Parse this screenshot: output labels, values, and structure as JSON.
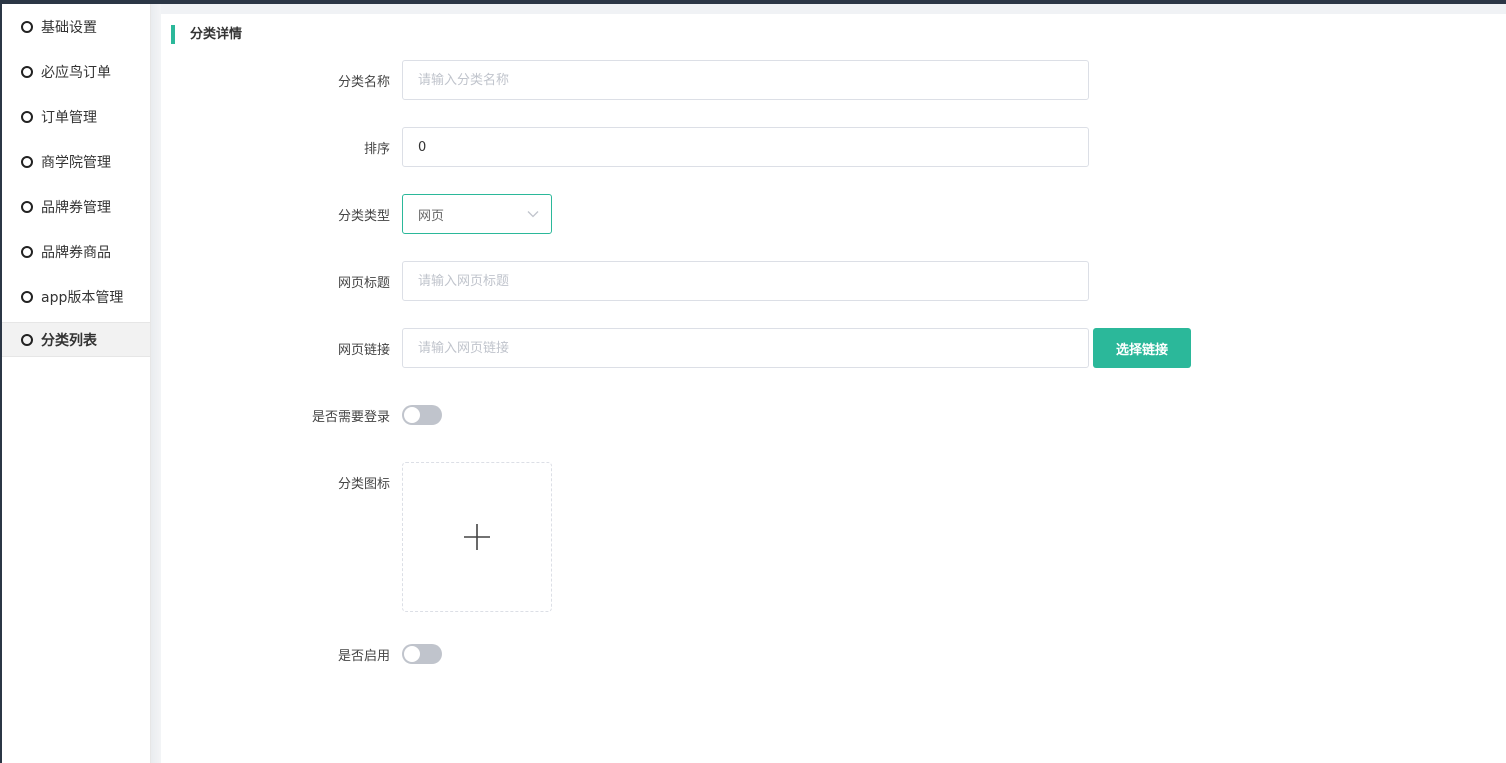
{
  "sidebar": {
    "items": [
      {
        "label": "基础设置"
      },
      {
        "label": "必应鸟订单"
      },
      {
        "label": "订单管理"
      },
      {
        "label": "商学院管理"
      },
      {
        "label": "品牌券管理"
      },
      {
        "label": "品牌券商品"
      },
      {
        "label": "app版本管理"
      },
      {
        "label": "分类列表",
        "active": true
      }
    ]
  },
  "form": {
    "section_title": "分类详情",
    "name": {
      "label": "分类名称",
      "placeholder": "请输入分类名称",
      "value": ""
    },
    "sort": {
      "label": "排序",
      "value": "0"
    },
    "type": {
      "label": "分类类型",
      "selected": "网页"
    },
    "web_title": {
      "label": "网页标题",
      "placeholder": "请输入网页标题",
      "value": ""
    },
    "web_link": {
      "label": "网页链接",
      "placeholder": "请输入网页链接",
      "value": "",
      "button_label": "选择链接"
    },
    "require_login": {
      "label": "是否需要登录",
      "on": false
    },
    "icon": {
      "label": "分类图标"
    },
    "enabled": {
      "label": "是否启用",
      "on": false
    }
  },
  "colors": {
    "accent": "#2bb89a",
    "switch_off": "#c0c4cc",
    "topbar": "#2b3645"
  },
  "icons": {
    "sidebar_item": "circle-icon",
    "select": "chevron-down-icon",
    "upload": "plus-icon"
  }
}
